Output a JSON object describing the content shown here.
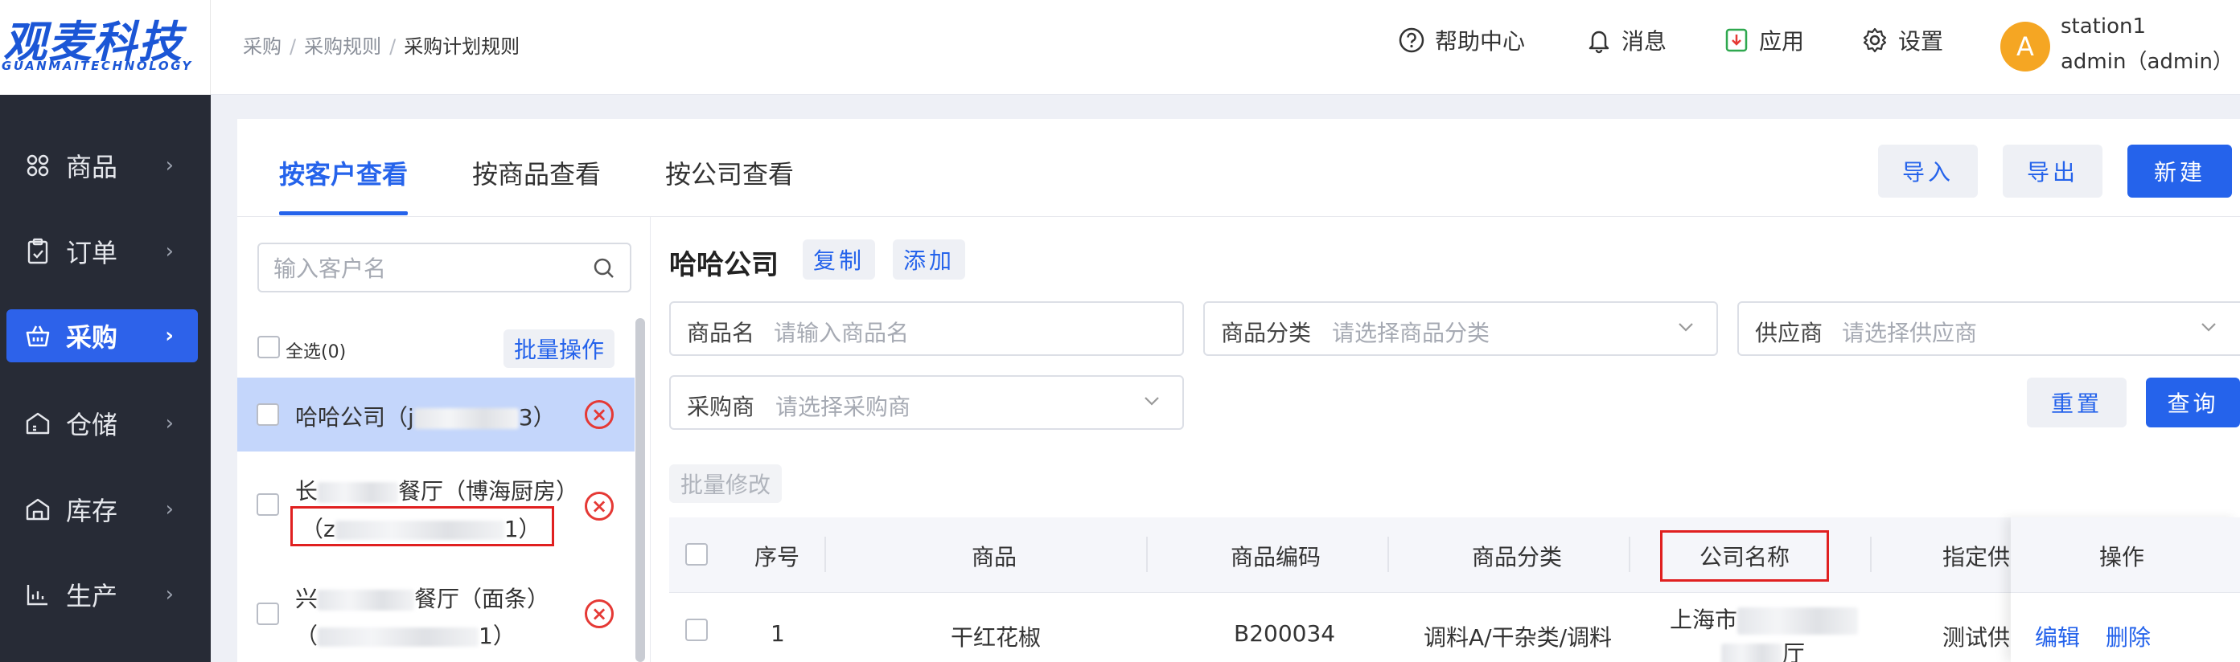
{
  "brand": {
    "name_cn": "观麦科技",
    "name_en": "GUANMAITECHNOLOGY"
  },
  "breadcrumb": [
    "采购",
    "采购规则",
    "采购计划规则"
  ],
  "header_actions": [
    {
      "label": "帮助中心",
      "icon": "help-circle-icon"
    },
    {
      "label": "消息",
      "icon": "bell-icon"
    },
    {
      "label": "应用",
      "icon": "app-download-icon"
    },
    {
      "label": "设置",
      "icon": "gear-icon"
    }
  ],
  "user": {
    "avatar_letter": "A",
    "station": "station1",
    "account": "admin（admin）",
    "avatar_color": "#f5a623"
  },
  "sidebar": {
    "items": [
      {
        "label": "商品",
        "icon": "product-icon"
      },
      {
        "label": "订单",
        "icon": "order-icon"
      },
      {
        "label": "采购",
        "icon": "purchase-basket-icon",
        "active": true
      },
      {
        "label": "仓储",
        "icon": "warehouse-icon"
      },
      {
        "label": "库存",
        "icon": "inventory-icon"
      },
      {
        "label": "生产",
        "icon": "production-chart-icon"
      }
    ]
  },
  "tabs": [
    "按客户查看",
    "按商品查看",
    "按公司查看"
  ],
  "toolbar": {
    "import": "导入",
    "export": "导出",
    "create": "新建"
  },
  "customer_panel": {
    "search_placeholder": "输入客户名",
    "select_all": "全选(0)",
    "batch_op": "批量操作",
    "customers": [
      {
        "line1_a": "哈哈公司（j",
        "line1_b": "3）",
        "selected": true
      },
      {
        "line1_a": "长",
        "line1_b": "餐厅（博海厨房）",
        "line2_a": "（z",
        "line2_b": "1）"
      },
      {
        "line1_a": "兴",
        "line1_b": "餐厅（面条）",
        "line2_a": "（",
        "line2_b": "1）"
      }
    ]
  },
  "detail": {
    "company": "哈哈公司",
    "copy": "复制",
    "add": "添加",
    "filters": {
      "product_label": "商品名",
      "product_ph": "请输入商品名",
      "category_label": "商品分类",
      "category_ph": "请选择商品分类",
      "supplier_label": "供应商",
      "supplier_ph": "请选择供应商",
      "buyer_label": "采购商",
      "buyer_ph": "请选择采购商"
    },
    "reset": "重置",
    "search": "查询",
    "batch_modify": "批量修改"
  },
  "table": {
    "columns": [
      "序号",
      "商品",
      "商品编码",
      "商品分类",
      "公司名称",
      "指定供",
      "操作"
    ],
    "rows": [
      {
        "index": "1",
        "product": "干红花椒",
        "code": "B200034",
        "category": "调料A/干杂类/调料",
        "company_a": "上海市",
        "company_b": "厅",
        "supplier": "测试供应",
        "edit": "编辑",
        "delete": "删除"
      }
    ]
  },
  "colors": {
    "primary": "#2563eb",
    "sidebar_bg": "#272b36",
    "active_nav": "#2d62ea",
    "danger": "#e53935"
  }
}
